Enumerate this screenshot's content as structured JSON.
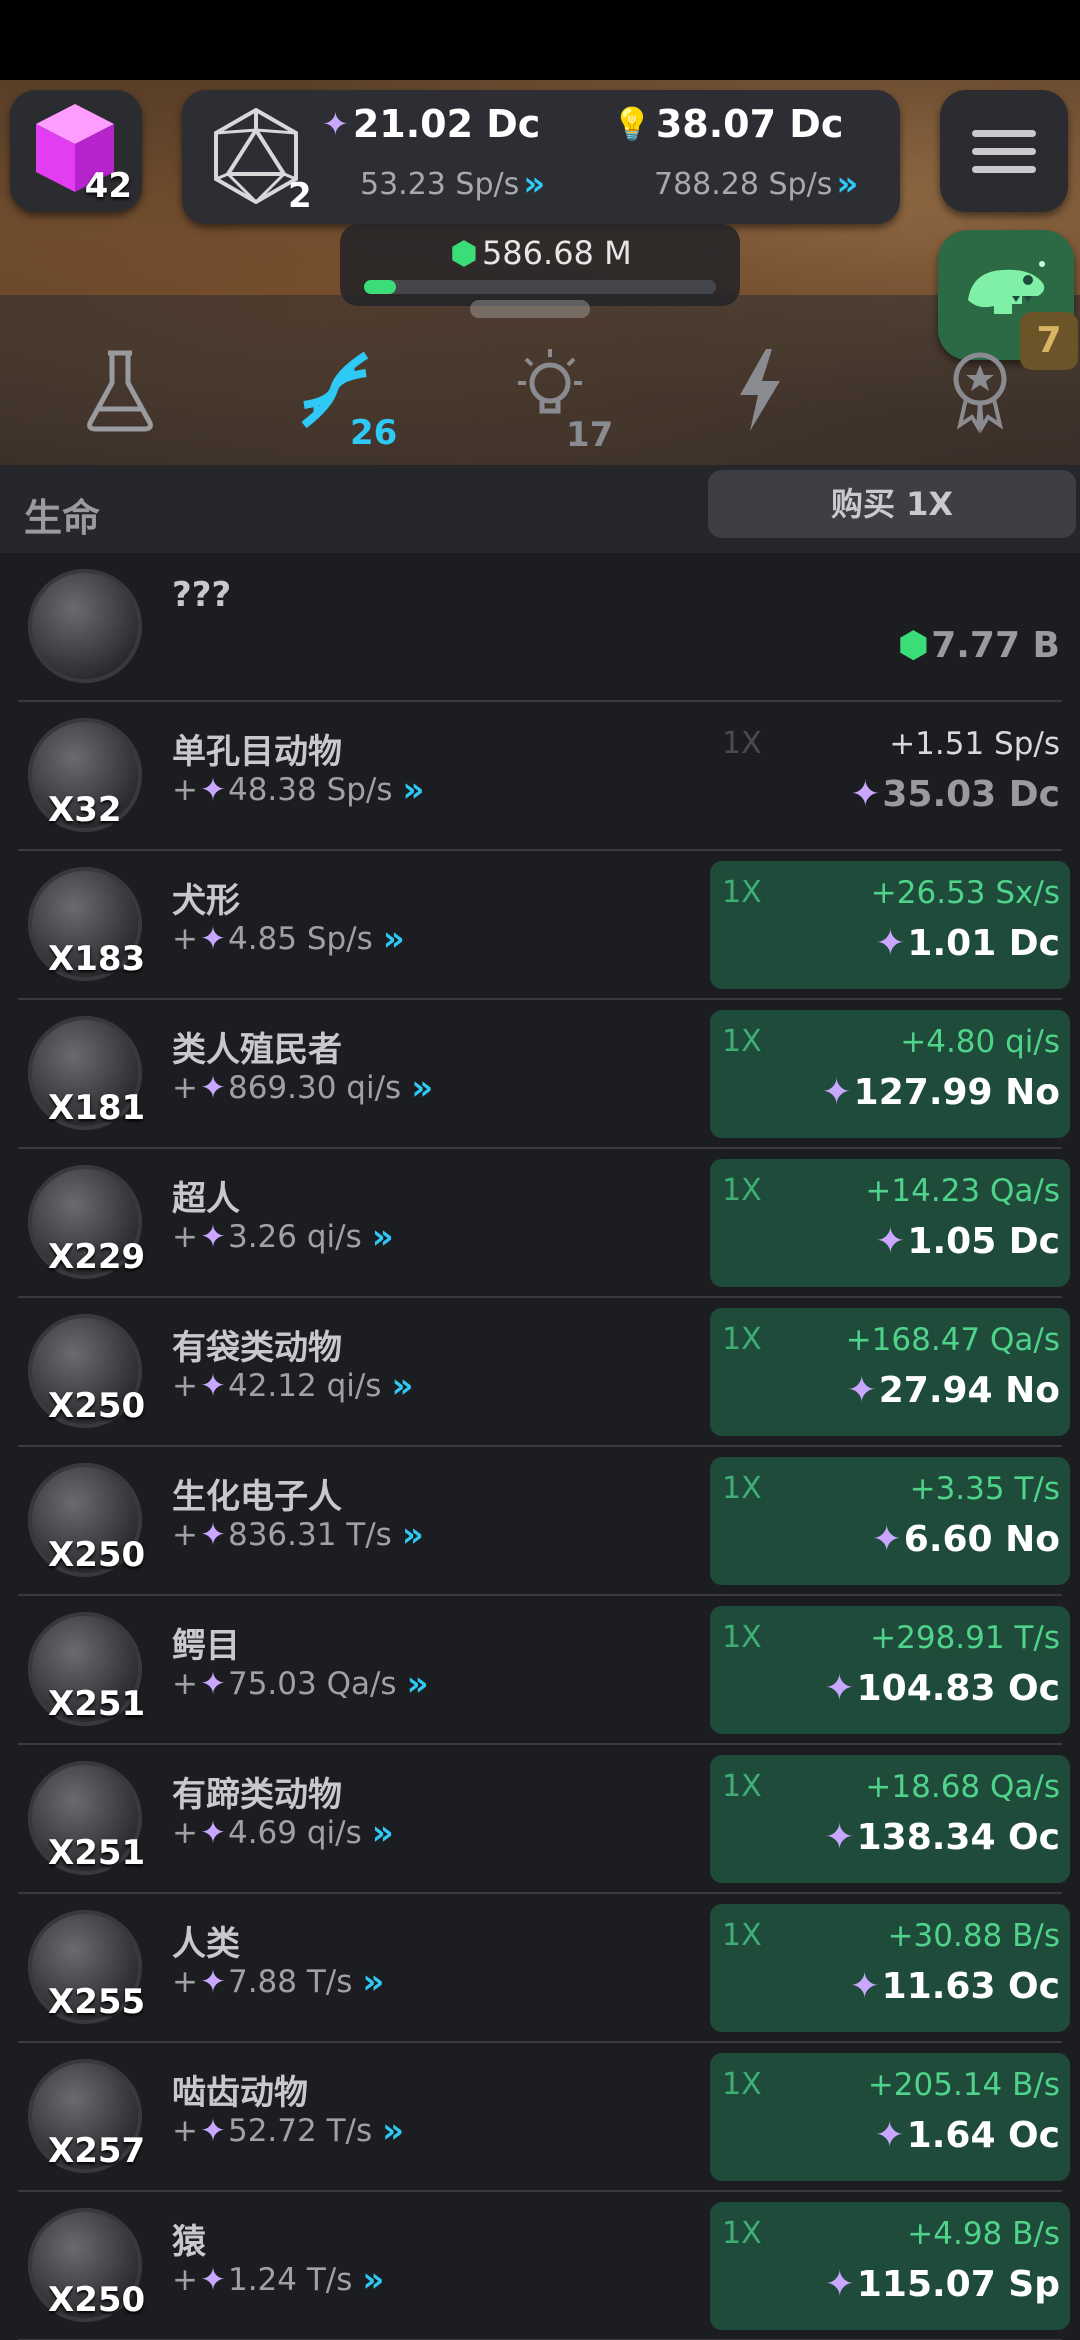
{
  "topbar": {
    "cube_count": "42",
    "d20_count": "2",
    "resource_a": {
      "value": "21.02 Dc",
      "rate": "53.23 Sp/s",
      "icon": "spark-icon"
    },
    "resource_b": {
      "value": "38.07 Dc",
      "rate": "788.28 Sp/s",
      "icon": "lightbulb-icon"
    },
    "gems": {
      "value": "586.68 M",
      "progress": 0.09
    },
    "dino_badge": "7"
  },
  "tabs": [
    {
      "name": "lab",
      "icon": "flask-icon",
      "count": ""
    },
    {
      "name": "life",
      "icon": "dna-icon",
      "count": "26"
    },
    {
      "name": "ideas",
      "icon": "lightbulb-icon",
      "count": "17"
    },
    {
      "name": "power",
      "icon": "lightning-icon",
      "count": ""
    },
    {
      "name": "achievements",
      "icon": "award-icon",
      "count": ""
    }
  ],
  "section": {
    "title": "生命",
    "buy_label": "购买 1X"
  },
  "items": [
    {
      "name": "???",
      "owned": "",
      "rate": "",
      "buy_qty": "",
      "gain": "",
      "cost": "7.77 B",
      "cost_icon": "gem-icon",
      "state": "locked"
    },
    {
      "name": "单孔目动物",
      "owned": "X32",
      "rate": "48.38 Sp/s",
      "buy_qty": "1X",
      "gain": "+1.51 Sp/s",
      "cost": "35.03 Dc",
      "cost_icon": "spark-icon",
      "state": "inactive"
    },
    {
      "name": "犬形",
      "owned": "X183",
      "rate": "4.85 Sp/s",
      "buy_qty": "1X",
      "gain": "+26.53 Sx/s",
      "cost": "1.01 Dc",
      "cost_icon": "spark-icon",
      "state": "active"
    },
    {
      "name": "类人殖民者",
      "owned": "X181",
      "rate": "869.30 qi/s",
      "buy_qty": "1X",
      "gain": "+4.80 qi/s",
      "cost": "127.99 No",
      "cost_icon": "spark-icon",
      "state": "active"
    },
    {
      "name": "超人",
      "owned": "X229",
      "rate": "3.26 qi/s",
      "buy_qty": "1X",
      "gain": "+14.23 Qa/s",
      "cost": "1.05 Dc",
      "cost_icon": "spark-icon",
      "state": "active"
    },
    {
      "name": "有袋类动物",
      "owned": "X250",
      "rate": "42.12 qi/s",
      "buy_qty": "1X",
      "gain": "+168.47 Qa/s",
      "cost": "27.94 No",
      "cost_icon": "spark-icon",
      "state": "active"
    },
    {
      "name": "生化电子人",
      "owned": "X250",
      "rate": "836.31 T/s",
      "buy_qty": "1X",
      "gain": "+3.35 T/s",
      "cost": "6.60 No",
      "cost_icon": "spark-icon",
      "state": "active"
    },
    {
      "name": "鳄目",
      "owned": "X251",
      "rate": "75.03 Qa/s",
      "buy_qty": "1X",
      "gain": "+298.91 T/s",
      "cost": "104.83 Oc",
      "cost_icon": "spark-icon",
      "state": "active"
    },
    {
      "name": "有蹄类动物",
      "owned": "X251",
      "rate": "4.69 qi/s",
      "buy_qty": "1X",
      "gain": "+18.68 Qa/s",
      "cost": "138.34 Oc",
      "cost_icon": "spark-icon",
      "state": "active"
    },
    {
      "name": "人类",
      "owned": "X255",
      "rate": "7.88 T/s",
      "buy_qty": "1X",
      "gain": "+30.88 B/s",
      "cost": "11.63 Oc",
      "cost_icon": "spark-icon",
      "state": "active"
    },
    {
      "name": "啮齿动物",
      "owned": "X257",
      "rate": "52.72 T/s",
      "buy_qty": "1X",
      "gain": "+205.14 B/s",
      "cost": "1.64 Oc",
      "cost_icon": "spark-icon",
      "state": "active"
    },
    {
      "name": "猿",
      "owned": "X250",
      "rate": "1.24 T/s",
      "buy_qty": "1X",
      "gain": "+4.98 B/s",
      "cost": "115.07 Sp",
      "cost_icon": "spark-icon",
      "state": "active"
    }
  ],
  "colors": {
    "accent_green": "#4fd38a",
    "card_green": "#1f4b3a",
    "chevron_cyan": "#2fc9f5",
    "gem_green": "#3bdd78"
  }
}
